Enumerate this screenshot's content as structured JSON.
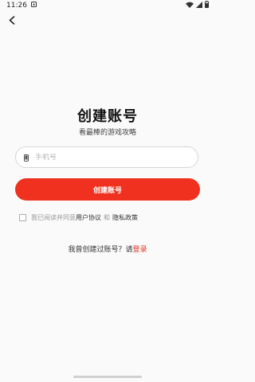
{
  "status_bar": {
    "time": "11:26"
  },
  "header": {
    "back_icon": "chevron-left"
  },
  "main": {
    "title": "创建账号",
    "subtitle": "看最棒的游戏攻略",
    "phone_field": {
      "icon": "phone-icon",
      "placeholder": "手机号",
      "value": ""
    },
    "create_button_label": "创建账号",
    "agreement": {
      "checked": false,
      "prefix": "我已阅读并同意",
      "user_agreement": "用户协议",
      "conjunction": "和",
      "privacy_policy": "隐私政策"
    },
    "login_prompt": {
      "text": "我曾创建过账号？请",
      "link": "登录"
    }
  },
  "colors": {
    "accent": "#f0311f",
    "link_red": "#e8321f",
    "background": "#fafafa"
  }
}
